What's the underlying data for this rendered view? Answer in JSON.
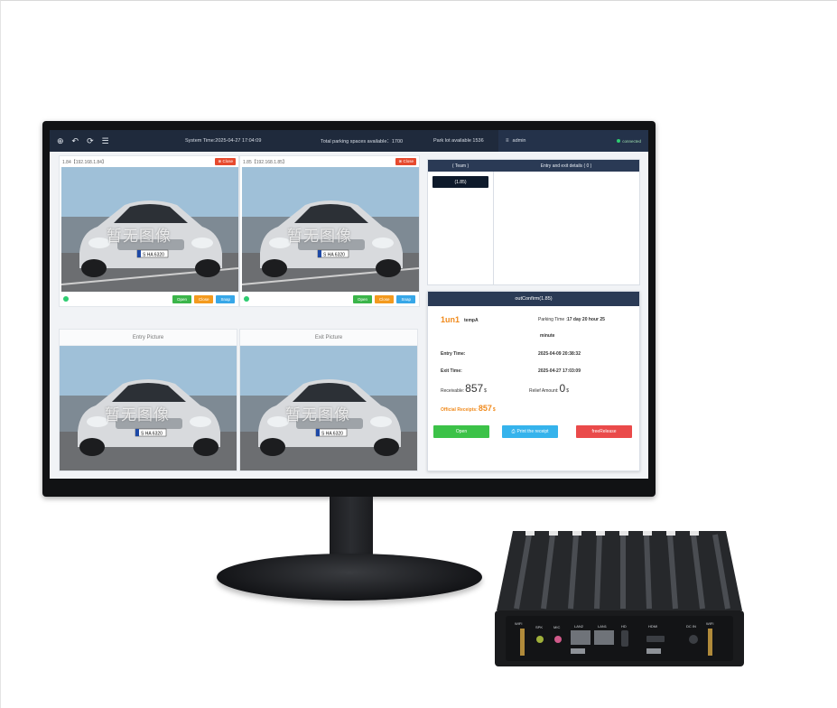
{
  "topbar": {
    "icons": [
      "settings-icon",
      "undo-icon",
      "logout-icon",
      "menu-icon"
    ],
    "system_time": "System Time:2025-04-27 17:04:09",
    "total_spaces": "Total parking spaces available：1700",
    "lot_available": "Park lot available 1536",
    "user": "admin",
    "connection": "connected"
  },
  "cameras": [
    {
      "title": "1.84【192.168.1.84】",
      "close": "Close",
      "buttons": [
        "Open",
        "Close",
        "Snap"
      ]
    },
    {
      "title": "1.85【192.168.1.85】",
      "close": "Close",
      "buttons": [
        "Open",
        "Close",
        "Snap"
      ]
    }
  ],
  "pictures": {
    "entry_title": "Entry Picture",
    "exit_title": "Exit Picture"
  },
  "watermark": "暂无图像",
  "plate": "S HA 6320",
  "entry_panel": {
    "tab_left": "( Team )",
    "tab_right": "Entry and exit details ( 0 )",
    "chip": "(1.85)"
  },
  "confirm": {
    "title": "outConfirm(1.85)",
    "plate": "1un1",
    "type": "tempA",
    "parking_time_label": "Parking Time :",
    "parking_time_value": "17 day 20 hour 25",
    "parking_time_cont": "minute",
    "entry_label": "Entry Time:",
    "entry_value": "2025-04-09 20:38:32",
    "exit_label": "Exit Time:",
    "exit_value": "2025-04-27 17:03:09",
    "receivable_label": "Receivable:",
    "receivable_value": "857",
    "receivable_unit": "$",
    "relief_label": "Relief Amount:",
    "relief_value": "0",
    "relief_unit": "$",
    "official_label": "Official Receipts:",
    "official_value": "857",
    "official_unit": "$",
    "btn_open": "Open",
    "btn_print": "Print the receipt",
    "btn_free": "freeRelease"
  },
  "pc_ports": [
    "SPK",
    "MIC",
    "LAN2",
    "LAN1",
    "HD",
    "HDMI",
    "DC IN",
    "WIFI"
  ]
}
